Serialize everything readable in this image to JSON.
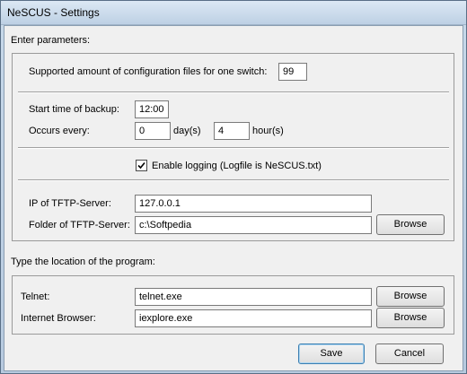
{
  "window": {
    "title": "NeSCUS - Settings"
  },
  "params": {
    "section_label": "Enter parameters:",
    "config_files": {
      "label": "Supported amount of configuration files for one switch:",
      "value": "99"
    },
    "backup_start": {
      "label": "Start time of backup:",
      "value": "12:00"
    },
    "occurs": {
      "label": "Occurs every:",
      "days_value": "0",
      "days_unit": "day(s)",
      "hours_value": "4",
      "hours_unit": "hour(s)"
    },
    "logging": {
      "label": "Enable logging (Logfile is NeSCUS.txt)",
      "checked": true
    },
    "tftp_ip": {
      "label": "IP of TFTP-Server:",
      "value": "127.0.0.1"
    },
    "tftp_folder": {
      "label": "Folder of TFTP-Server:",
      "value": "c:\\Softpedia",
      "browse_label": "Browse"
    }
  },
  "programs": {
    "section_label": "Type the location of the program:",
    "telnet": {
      "label": "Telnet:",
      "value": "telnet.exe",
      "browse_label": "Browse"
    },
    "browser": {
      "label": "Internet Browser:",
      "value": "iexplore.exe",
      "browse_label": "Browse"
    }
  },
  "footer": {
    "save_label": "Save",
    "cancel_label": "Cancel"
  }
}
